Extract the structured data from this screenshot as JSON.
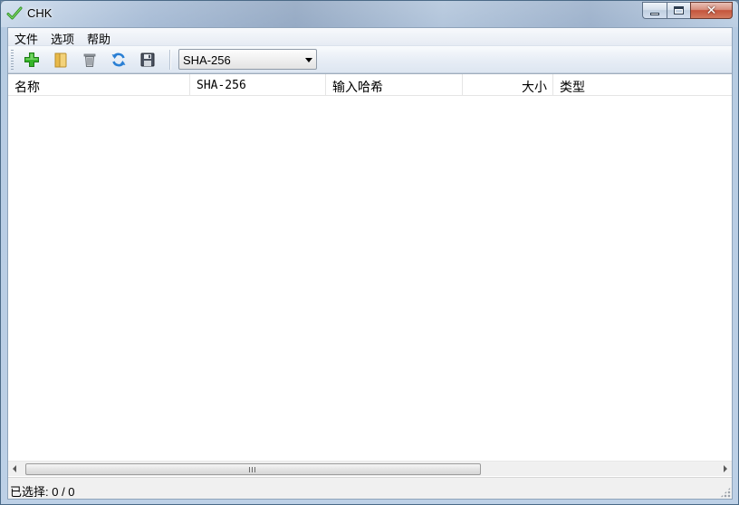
{
  "window": {
    "title": "CHK",
    "icon": "check-icon",
    "accent_color": "#4aa832"
  },
  "menu": {
    "items": [
      "文件",
      "选项",
      "帮助"
    ]
  },
  "toolbar": {
    "buttons": [
      {
        "name": "add-button",
        "icon": "plus-icon"
      },
      {
        "name": "open-button",
        "icon": "folder-icon"
      },
      {
        "name": "delete-button",
        "icon": "trash-icon"
      },
      {
        "name": "refresh-button",
        "icon": "refresh-icon"
      },
      {
        "name": "save-button",
        "icon": "floppy-icon"
      }
    ],
    "algorithm_select": {
      "value": "SHA-256"
    }
  },
  "list": {
    "columns": [
      "名称",
      "SHA-256",
      "输入哈希",
      "大小",
      "类型"
    ],
    "rows": []
  },
  "status": {
    "text": "已选择: 0 / 0"
  },
  "scrollbar": {
    "grip": "III"
  }
}
